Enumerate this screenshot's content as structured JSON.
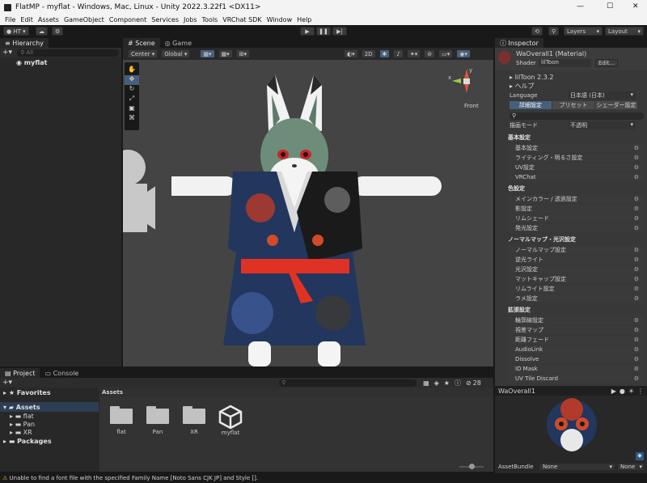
{
  "window": {
    "title": "FlatMP - myflat - Windows, Mac, Linux - Unity 2022.3.22f1 <DX11>",
    "minimize": "—",
    "maximize": "☐",
    "close": "✕"
  },
  "menu": [
    "File",
    "Edit",
    "Assets",
    "GameObject",
    "Component",
    "Services",
    "Jobs",
    "Tools",
    "VRChat SDK",
    "Window",
    "Help"
  ],
  "toolbar": {
    "account": "HT",
    "layers": "Layers",
    "layout": "Layout"
  },
  "hierarchy": {
    "tab": "Hierarchy",
    "search_placeholder": "All",
    "scene_item": "myflat"
  },
  "scene": {
    "tab_scene": "Scene",
    "tab_game": "Game",
    "pivot": "Center",
    "space": "Global",
    "mode_2d": "2D",
    "persp_label": "Front",
    "axis_x": "x",
    "axis_y": "y"
  },
  "inspector": {
    "tab": "Inspector",
    "material_name": "WaOverall1 (Material)",
    "shader_label": "Shader",
    "shader_value": "lilToon",
    "edit_button": "Edit...",
    "version": "lilToon 2.3.2",
    "help": "ヘルプ",
    "language_label": "Language",
    "language_value": "日本語 (日本)",
    "tabs": [
      "詳細設定",
      "プリセット",
      "シェーダー設定"
    ],
    "render_mode_label": "描画モード",
    "render_mode_value": "不透明",
    "groups": [
      {
        "title": "基本設定",
        "items": [
          "基本設定",
          "ライティング・明るさ設定",
          "UV設定",
          "VRChat"
        ]
      },
      {
        "title": "色設定",
        "items": [
          "メインカラー / 透過設定",
          "影設定",
          "リムシェード",
          "発光設定"
        ]
      },
      {
        "title": "ノーマルマップ・光沢設定",
        "items": [
          "ノーマルマップ設定",
          "逆光ライト",
          "光沢設定",
          "マットキャップ設定",
          "リムライト設定",
          "ラメ設定"
        ]
      },
      {
        "title": "拡張設定",
        "items": [
          "輪郭線設定",
          "視差マップ",
          "距離フェード",
          "AudioLink",
          "Dissolve",
          "ID Mask",
          "UV Tile Discard"
        ]
      }
    ],
    "preview_name": "WaOverall1",
    "assetbundle_label": "AssetBundle",
    "assetbundle_value": "None",
    "assetbundle_variant": "None"
  },
  "project": {
    "tab_project": "Project",
    "tab_console": "Console",
    "favorites": "Favorites",
    "assets_root": "Assets",
    "folders": [
      "flat",
      "Pan",
      "XR"
    ],
    "packages": "Packages",
    "breadcrumb": "Assets",
    "assets": [
      "flat",
      "Pan",
      "XR",
      "myflat"
    ],
    "hidden_count": "28"
  },
  "status": {
    "message": "Unable to find a font file with the specified Family Name [Noto Sans CJK JP] and Style []."
  }
}
